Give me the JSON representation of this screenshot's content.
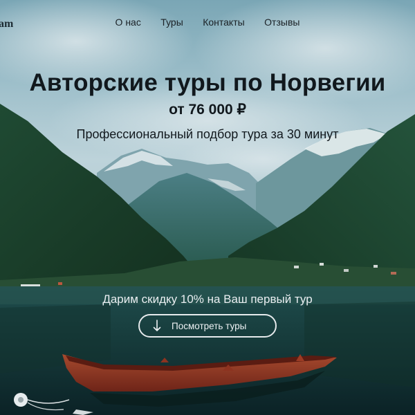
{
  "site": {
    "logo_text": "am"
  },
  "nav": {
    "items": [
      "О нас",
      "Туры",
      "Контакты",
      "Отзывы"
    ]
  },
  "hero": {
    "title": "Авторские туры по Норвегии",
    "price": "от 76 000 ₽",
    "subtitle": "Профессиональный подбор тура за 30 минут",
    "discount": "Дарим скидку 10% на Ваш первый тур",
    "cta_label": "Посмотреть туры",
    "cta_icon": "arrow-down-icon"
  },
  "colors": {
    "heading_text": "#11181d",
    "light_text": "#e9eef1",
    "sky": "#6e9dae",
    "forest": "#1e4a32",
    "water": "#173d3c",
    "boat": "#8a3422"
  }
}
